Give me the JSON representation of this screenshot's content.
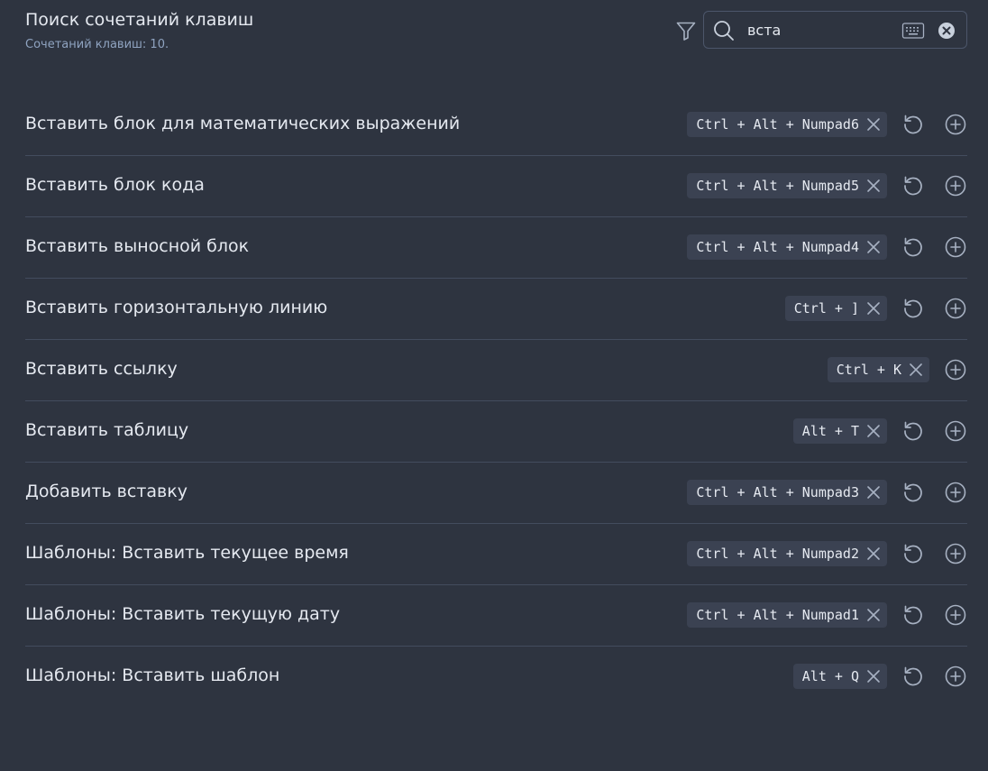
{
  "header": {
    "title": "Поиск сочетаний клавиш",
    "count_label": "Сочетаний клавиш: 10."
  },
  "search": {
    "value": "вста",
    "placeholder": ""
  },
  "colors": {
    "background": "#2e3440",
    "chip_bg": "#3b4252",
    "divider": "#434c5e",
    "icon": "#a7b1c2"
  },
  "hotkeys": [
    {
      "command": "Вставить блок для математических выражений",
      "hotkey": "Ctrl + Alt + Numpad6",
      "has_reset": true
    },
    {
      "command": "Вставить блок кода",
      "hotkey": "Ctrl + Alt + Numpad5",
      "has_reset": true
    },
    {
      "command": "Вставить выносной блок",
      "hotkey": "Ctrl + Alt + Numpad4",
      "has_reset": true
    },
    {
      "command": "Вставить горизонтальную линию",
      "hotkey": "Ctrl + ]",
      "has_reset": true
    },
    {
      "command": "Вставить ссылку",
      "hotkey": "Ctrl + K",
      "has_reset": false
    },
    {
      "command": "Вставить таблицу",
      "hotkey": "Alt + T",
      "has_reset": true
    },
    {
      "command": "Добавить вставку",
      "hotkey": "Ctrl + Alt + Numpad3",
      "has_reset": true
    },
    {
      "command": "Шаблоны: Вставить текущее время",
      "hotkey": "Ctrl + Alt + Numpad2",
      "has_reset": true
    },
    {
      "command": "Шаблоны: Вставить текущую дату",
      "hotkey": "Ctrl + Alt + Numpad1",
      "has_reset": true
    },
    {
      "command": "Шаблоны: Вставить шаблон",
      "hotkey": "Alt + Q",
      "has_reset": true
    }
  ],
  "icons": {
    "filter": "filter-icon",
    "search": "search-icon",
    "keyboard": "keyboard-icon",
    "clear": "clear-circle-icon",
    "remove_hotkey": "close-icon",
    "reset": "reset-icon",
    "add": "plus-circle-icon"
  }
}
